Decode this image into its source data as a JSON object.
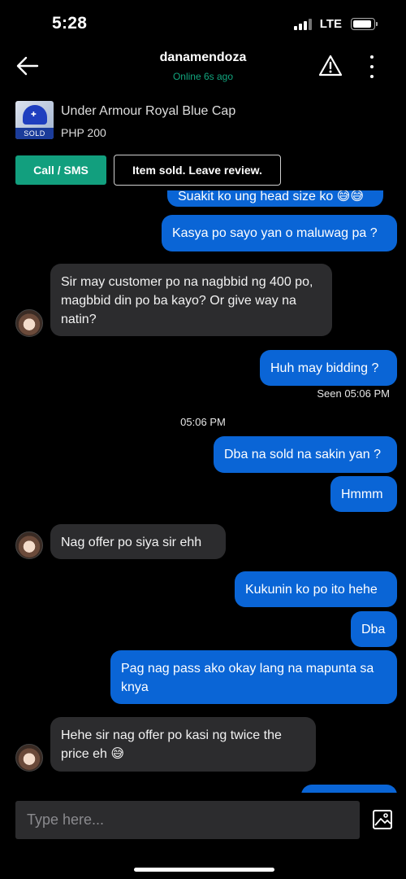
{
  "status_bar": {
    "time": "5:28",
    "network": "LTE"
  },
  "header": {
    "username": "danamendoza",
    "presence": "Online 6s ago"
  },
  "product": {
    "title": "Under Armour Royal Blue Cap",
    "price": "PHP 200",
    "badge": "SOLD"
  },
  "actions": {
    "call_label": "Call / SMS",
    "review_label": "Item sold. Leave review."
  },
  "messages": [
    {
      "from": "me",
      "text": "Suakit ko ung head size ko 😅😅"
    },
    {
      "from": "me",
      "text": "Kasya po sayo yan o maluwag pa ?"
    },
    {
      "from": "them",
      "text": "Sir may customer po na nagbbid ng 400 po, magbbid din po ba kayo? Or give way na natin?"
    },
    {
      "from": "me",
      "text": "Huh may bidding ?"
    },
    {
      "from": "me",
      "text": "Dba na sold na sakin yan ?"
    },
    {
      "from": "me",
      "text": "Hmmm"
    },
    {
      "from": "them",
      "text": "Nag offer po siya sir ehh"
    },
    {
      "from": "me",
      "text": "Kukunin ko po ito hehe"
    },
    {
      "from": "me",
      "text": "Dba"
    },
    {
      "from": "me",
      "text": "Pag nag pass ako okay lang na mapunta sa knya"
    },
    {
      "from": "them",
      "text": "Hehe sir nag offer po kasi ng twice the price eh 😅"
    }
  ],
  "seen_receipt": "Seen 05:06 PM",
  "time_separator": "05:06 PM",
  "composer": {
    "placeholder": "Type here..."
  },
  "colors": {
    "accent_green": "#129f7e",
    "outgoing_bubble": "#0a65d6",
    "incoming_bubble": "#2c2c2e",
    "background": "#000000"
  },
  "icons": [
    "back-arrow-icon",
    "warning-icon",
    "more-vertical-icon",
    "image-attach-icon"
  ]
}
